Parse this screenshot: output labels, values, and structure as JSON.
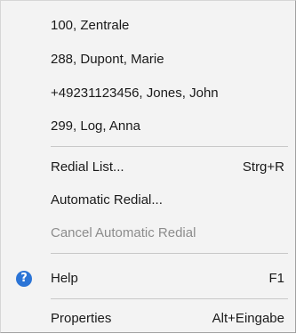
{
  "menu": {
    "recent_calls": [
      {
        "label": "100, Zentrale"
      },
      {
        "label": "288, Dupont, Marie"
      },
      {
        "label": "+49231123456,  Jones, John"
      },
      {
        "label": "299, Log, Anna"
      }
    ],
    "redial_list": {
      "label": "Redial List...",
      "shortcut": "Strg+R"
    },
    "automatic_redial": {
      "label": "Automatic Redial..."
    },
    "cancel_automatic_redial": {
      "label": "Cancel Automatic Redial",
      "enabled": false
    },
    "help": {
      "label": "Help",
      "shortcut": "F1",
      "icon": "help-icon",
      "icon_glyph": "?",
      "icon_color": "#2b74d6"
    },
    "properties": {
      "label": "Properties",
      "shortcut": "Alt+Eingabe"
    }
  }
}
